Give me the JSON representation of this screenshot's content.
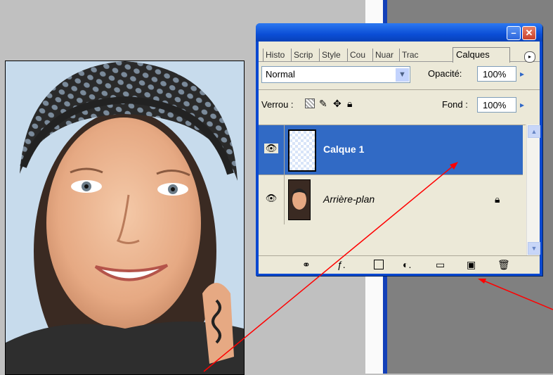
{
  "palette": {
    "tabs": [
      "Histo",
      "Scrip",
      "Style",
      "Cou",
      "Nuar",
      "Trac"
    ],
    "active_tab": "Calques",
    "blend_mode": "Normal",
    "opacity_label": "Opacité:",
    "opacity_value": "100%",
    "lock_label": "Verrou :",
    "fill_label": "Fond :",
    "fill_value": "100%",
    "layers": [
      {
        "name": "Calque 1",
        "selected": true
      },
      {
        "name": "Arrière-plan",
        "selected": false,
        "locked": true
      }
    ]
  },
  "colors": {
    "titlebar": "#0b4ed6",
    "selection": "#316ac5",
    "arrow": "#ff0000"
  }
}
